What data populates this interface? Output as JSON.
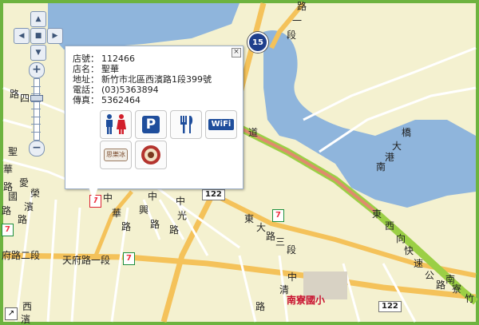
{
  "store_info": {
    "store_id": {
      "label": "店號：",
      "value": "112466"
    },
    "store_name": {
      "label": "店名：",
      "value": "聖華"
    },
    "address": {
      "label": "地址：",
      "value": "新竹市北區西濱路1段399號"
    },
    "phone": {
      "label": "電話：",
      "value": "(03)5363894"
    },
    "fax": {
      "label": "傳真：",
      "value": "5362464"
    },
    "close_symbol": "×",
    "services": [
      {
        "name": "restroom",
        "icon": "restroom-icon",
        "color": "#1f4e9c"
      },
      {
        "name": "parking",
        "icon": "parking-icon",
        "label": "P",
        "color": "#1f4e9c"
      },
      {
        "name": "dining",
        "icon": "dining-icon",
        "color": "#1f4e9c"
      },
      {
        "name": "wifi",
        "icon": "wifi-icon",
        "label": "WiFi",
        "color": "#1f4e9c"
      },
      {
        "name": "ice",
        "icon": "ice-shop-icon",
        "label": "思樂冰"
      },
      {
        "name": "coffee",
        "icon": "coffee-icon"
      }
    ]
  },
  "map": {
    "route_shields": [
      "122",
      "122"
    ],
    "highway_number": "15",
    "school_label": "南寮國小",
    "road_labels": {
      "west_binhai_road": [
        "西",
        "濱",
        "路",
        "一",
        "段"
      ],
      "tianfu_road_label": "天府路一段",
      "tianfu_lane": "府路二段",
      "shenghua": [
        "聖",
        "華",
        "路"
      ],
      "aiguo": [
        "愛",
        "國",
        "路"
      ],
      "rongbin": [
        "榮",
        "濱",
        "路"
      ],
      "zhonghua": [
        "中",
        "華",
        "路"
      ],
      "zhongxing": [
        "中",
        "興",
        "路"
      ],
      "zhongguang": [
        "中",
        "光",
        "路"
      ],
      "dongda_road": [
        "東",
        "大",
        "路",
        "三",
        "段"
      ],
      "dongxi_expressway": [
        "東",
        "西",
        "向",
        "快",
        "速",
        "公",
        "路",
        "南",
        "寮",
        "竹"
      ],
      "zhongqing": [
        "中",
        "清",
        "路"
      ],
      "qiao_gang_nan": [
        "橋",
        "大",
        "港",
        "南"
      ],
      "top_duan": [
        "路",
        "一",
        "段"
      ],
      "xi_bin_bottom": [
        "西",
        "濱"
      ],
      "road_si": [
        "路",
        "四"
      ],
      "dao": "道"
    },
    "colors": {
      "land": "#f4f1d0",
      "water": "#8fb5dc",
      "major_road": "#f4c25a",
      "expressway": "#9bcf45",
      "frame": "#6db33f"
    }
  },
  "controls": {
    "pan_up": "▲",
    "pan_down": "▼",
    "pan_left": "◀",
    "pan_right": "▶",
    "pan_center": "■",
    "zoom_in": "+",
    "zoom_out": "−",
    "corner_symbol": "↗",
    "zoom_level": 0.32
  }
}
